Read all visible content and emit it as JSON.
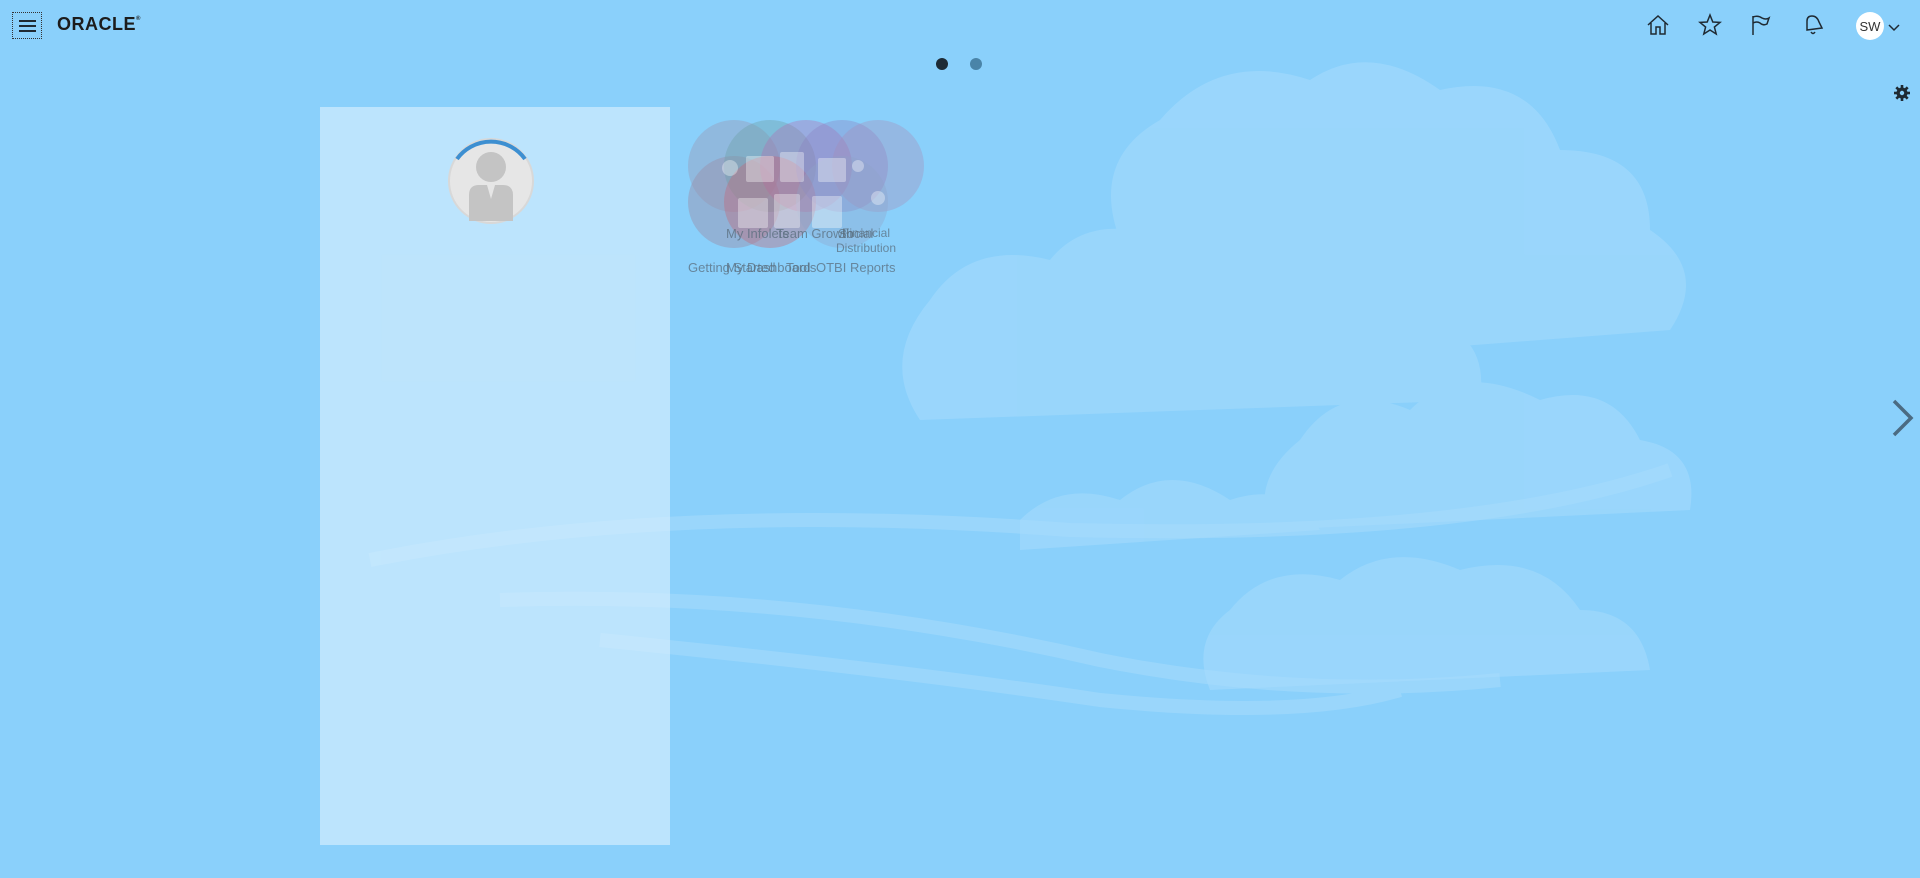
{
  "brand": {
    "logo_text": "ORACLE"
  },
  "header": {
    "icons": [
      "home-icon",
      "star-icon",
      "flag-icon",
      "bell-icon"
    ],
    "user_initials": "SW"
  },
  "pagination": {
    "pages": 2,
    "current": 1
  },
  "welcome": {
    "profile_photo": "user-placeholder"
  },
  "apps": [
    {
      "label": "Getting Started",
      "color": "#9a8ea8"
    },
    {
      "label": "My Infolets",
      "color": "#b46ab0"
    },
    {
      "label": "My Dashboard",
      "color": "#6fa0a8"
    },
    {
      "label": "Team Growth",
      "color": "#c06a7a"
    },
    {
      "label": "Social",
      "color": "#8a7fc0"
    },
    {
      "label": "Tools",
      "color": "#7a8ab8"
    },
    {
      "label": "Financial Distribution",
      "color": "#a58cb8"
    },
    {
      "label": "OTBI Reports",
      "color": "#8fa4c8"
    }
  ],
  "colors": {
    "background": "#8ad0fb",
    "panel": "#dcf0fd",
    "accent": "#3d8fd1"
  }
}
